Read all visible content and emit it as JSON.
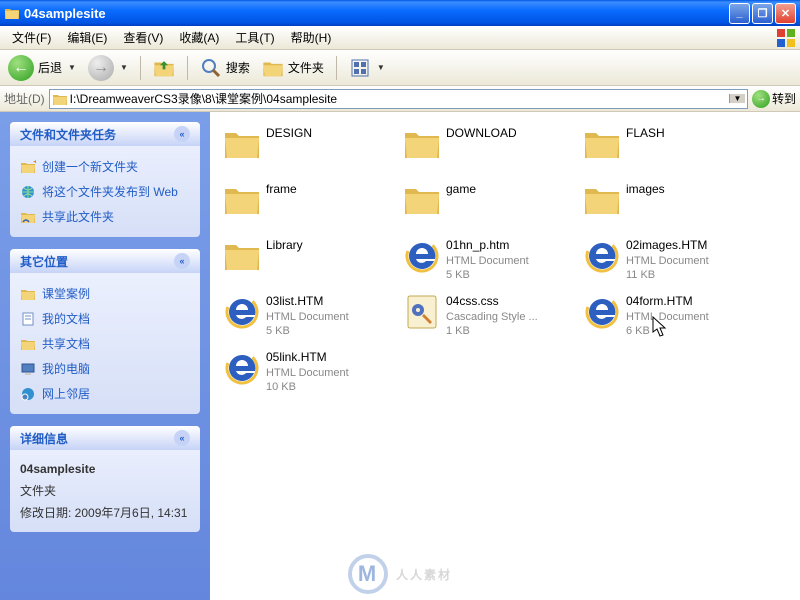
{
  "window": {
    "title": "04samplesite"
  },
  "menu": {
    "file": "文件(F)",
    "edit": "编辑(E)",
    "view": "查看(V)",
    "favorites": "收藏(A)",
    "tools": "工具(T)",
    "help": "帮助(H)"
  },
  "toolbar": {
    "back": "后退",
    "search": "搜索",
    "folders": "文件夹"
  },
  "address": {
    "label": "地址(D)",
    "path": "I:\\DreamweaverCS3录像\\8\\课堂案例\\04samplesite",
    "go": "转到"
  },
  "sidebar": {
    "tasks": {
      "title": "文件和文件夹任务",
      "new_folder": "创建一个新文件夹",
      "publish": "将这个文件夹发布到 Web",
      "share": "共享此文件夹"
    },
    "other": {
      "title": "其它位置",
      "parent": "课堂案例",
      "mydocs": "我的文档",
      "shared": "共享文档",
      "mycomputer": "我的电脑",
      "network": "网上邻居"
    },
    "details": {
      "title": "详细信息",
      "name": "04samplesite",
      "type": "文件夹",
      "modified_label": "修改日期: 2009年7月6日, 14:31"
    }
  },
  "files": [
    {
      "name": "DESIGN",
      "kind": "folder"
    },
    {
      "name": "DOWNLOAD",
      "kind": "folder"
    },
    {
      "name": "FLASH",
      "kind": "folder"
    },
    {
      "name": "frame",
      "kind": "folder"
    },
    {
      "name": "game",
      "kind": "folder"
    },
    {
      "name": "images",
      "kind": "folder"
    },
    {
      "name": "Library",
      "kind": "folder"
    },
    {
      "name": "01hn_p.htm",
      "kind": "ie",
      "type": "HTML Document",
      "size": "5 KB"
    },
    {
      "name": "02images.HTM",
      "kind": "ie",
      "type": "HTML Document",
      "size": "11 KB"
    },
    {
      "name": "03list.HTM",
      "kind": "ie",
      "type": "HTML Document",
      "size": "5 KB"
    },
    {
      "name": "04css.css",
      "kind": "css",
      "type": "Cascading Style ...",
      "size": "1 KB"
    },
    {
      "name": "04form.HTM",
      "kind": "ie",
      "type": "HTML Document",
      "size": "6 KB"
    },
    {
      "name": "05link.HTM",
      "kind": "ie",
      "type": "HTML Document",
      "size": "10 KB"
    }
  ],
  "watermark": "人人素材"
}
